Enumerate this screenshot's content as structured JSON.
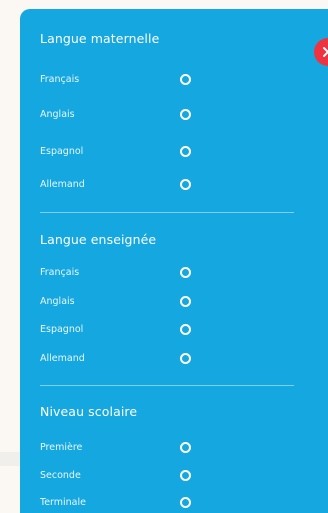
{
  "sections": [
    {
      "title": "Langue maternelle",
      "options": [
        "Français",
        "Anglais",
        "Espagnol",
        "Allemand"
      ]
    },
    {
      "title": "Langue enseignée",
      "options": [
        "Français",
        "Anglais",
        "Espagnol",
        "Allemand"
      ]
    },
    {
      "title": "Niveau scolaire",
      "options": [
        "Première",
        "Seconde",
        "Terminale"
      ]
    }
  ],
  "close_button": {
    "icon": "close-icon"
  },
  "colors": {
    "panel": "#14a7e0",
    "close": "#ef3340",
    "page_background": "#fbf7f3"
  }
}
